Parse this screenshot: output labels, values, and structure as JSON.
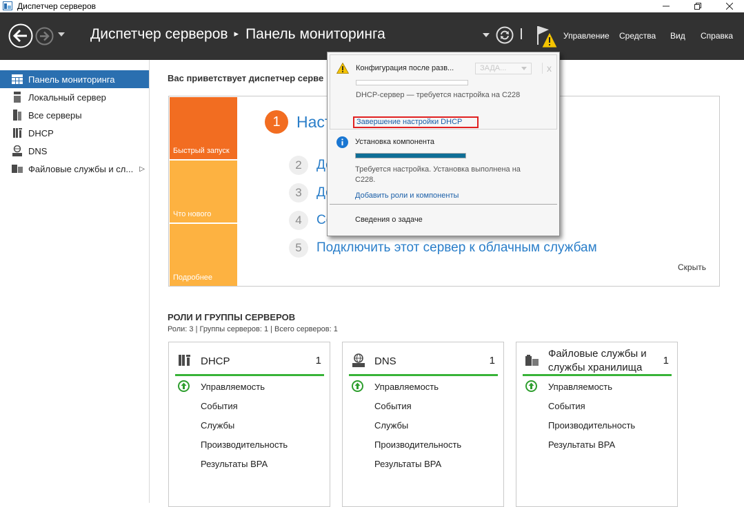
{
  "window": {
    "title": "Диспетчер серверов"
  },
  "header": {
    "breadcrumb_root": "Диспетчер серверов",
    "breadcrumb_separator": "▸",
    "breadcrumb_current": "Панель мониторинга",
    "menu": {
      "manage": "Управление",
      "tools": "Средства",
      "view": "Вид",
      "help": "Справка"
    }
  },
  "sidebar": {
    "items": [
      {
        "label": "Панель мониторинга",
        "icon": "dashboard-icon",
        "active": true
      },
      {
        "label": "Локальный сервер",
        "icon": "local-server-icon"
      },
      {
        "label": "Все серверы",
        "icon": "all-servers-icon"
      },
      {
        "label": "DHCP",
        "icon": "dhcp-icon"
      },
      {
        "label": "DNS",
        "icon": "dns-icon"
      },
      {
        "label": "Файловые службы и сл...",
        "icon": "file-services-icon"
      }
    ],
    "more_glyph": "▷"
  },
  "main": {
    "welcome_title": "Вас приветствует диспетчер серве",
    "tiles": [
      "Быстрый запуск",
      "Что нового",
      "Подробнее"
    ],
    "steps": [
      {
        "num": "1",
        "text": "Наст"
      },
      {
        "num": "2",
        "text": "До"
      },
      {
        "num": "3",
        "text": "До"
      },
      {
        "num": "4",
        "text": "Со"
      },
      {
        "num": "5",
        "text": "Подключить этот сервер к облачным службам"
      }
    ],
    "hide_label": "Скрыть",
    "roles_title": "РОЛИ И ГРУППЫ СЕРВЕРОВ",
    "roles_subtitle": "Роли: 3 | Группы серверов: 1 | Всего серверов: 1",
    "cards": [
      {
        "name": "DHCP",
        "count": "1",
        "rows": [
          "Управляемость",
          "События",
          "Службы",
          "Производительность",
          "Результаты BPA"
        ]
      },
      {
        "name": "DNS",
        "count": "1",
        "rows": [
          "Управляемость",
          "События",
          "Службы",
          "Производительность",
          "Результаты BPA"
        ]
      },
      {
        "name_line1": "Файловые службы и",
        "name_line2": "службы хранилища",
        "count": "1",
        "rows": [
          "Управляемость",
          "События",
          "Производительность",
          "Результаты BPA"
        ]
      }
    ]
  },
  "notifications": {
    "item1": {
      "title": "Конфигурация после разв...",
      "task_button": "ЗАДА...",
      "close": "x",
      "desc": "DHCP-сервер — требуется настройка на C228",
      "link": "Завершение настройки DHCP"
    },
    "item2": {
      "title": "Установка компонента",
      "progress": 1.0,
      "desc": "Требуется настройка. Установка выполнена на C228.",
      "link": "Добавить роли и компоненты"
    },
    "task_details": "Сведения о задаче"
  },
  "colors": {
    "header_bg": "#323232",
    "active_item": "#2a6fb0",
    "tile_orange": "#f26d21",
    "tile_yellow": "#fdb241",
    "status_green": "#38b338",
    "link_blue": "#1a5fa8"
  }
}
